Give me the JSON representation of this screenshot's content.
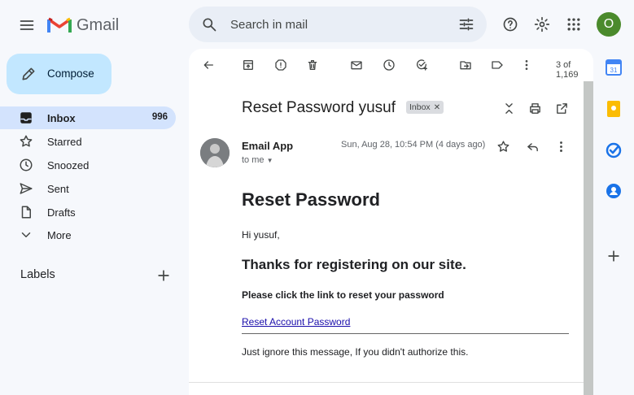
{
  "app": {
    "name": "Gmail",
    "avatar_initial": "O"
  },
  "search": {
    "placeholder": "Search in mail"
  },
  "sidebar": {
    "compose_label": "Compose",
    "items": [
      {
        "label": "Inbox",
        "count": "996",
        "icon": "inbox-icon"
      },
      {
        "label": "Starred",
        "count": "",
        "icon": "star-icon"
      },
      {
        "label": "Snoozed",
        "count": "",
        "icon": "clock-icon"
      },
      {
        "label": "Sent",
        "count": "",
        "icon": "send-icon"
      },
      {
        "label": "Drafts",
        "count": "",
        "icon": "file-icon"
      },
      {
        "label": "More",
        "count": "",
        "icon": "chevron-down-icon"
      }
    ],
    "labels_heading": "Labels"
  },
  "toolbar": {
    "page_count": "3 of 1,169"
  },
  "email": {
    "subject": "Reset Password yusuf",
    "label_chip": "Inbox",
    "sender": "Email App",
    "recipient": "to me",
    "date": "Sun, Aug 28, 10:54 PM (4 days ago)",
    "body": {
      "heading": "Reset Password",
      "greeting": "Hi yusuf,",
      "thanks": "Thanks for registering on our site.",
      "instruction": "Please click the link to reset your password",
      "link_text": "Reset Account Password",
      "footer": "Just ignore this message, If you didn't authorize this."
    }
  },
  "colors": {
    "background": "#f6f8fc",
    "compose": "#c2e7ff",
    "inbox_active": "#d3e3fd",
    "avatar": "#4b8a2c",
    "link": "#1a0dab"
  }
}
